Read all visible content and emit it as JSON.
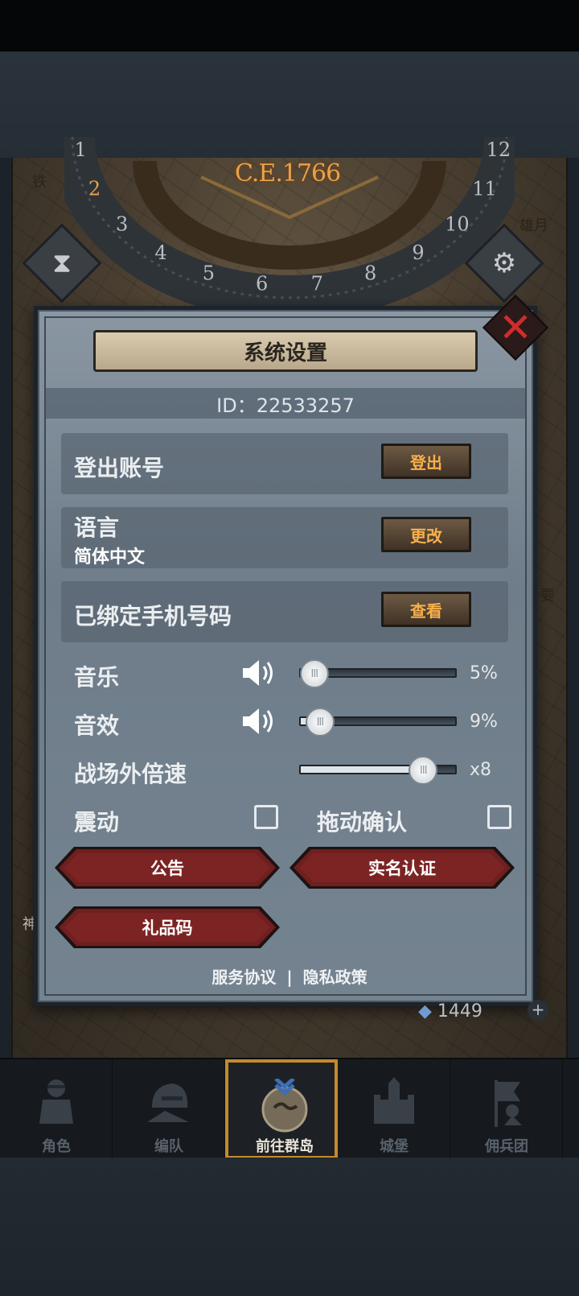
{
  "map": {
    "era": "C.E.1766",
    "dial_numbers": [
      "1",
      "2",
      "3",
      "4",
      "5",
      "6",
      "7",
      "8",
      "9",
      "10",
      "11",
      "12"
    ],
    "labels": {
      "top_left": "铁",
      "top_right": "雄月",
      "side_right": "要",
      "side_left": "神"
    },
    "resource_value": "1449"
  },
  "dialog": {
    "title": "系统设置",
    "id_text": "ID：22533257",
    "rows": {
      "logout": {
        "label": "登出账号",
        "button": "登出"
      },
      "language": {
        "label": "语言",
        "value": "简体中文",
        "button": "更改"
      },
      "phone": {
        "label": "已绑定手机号码",
        "button": "查看"
      }
    },
    "sliders": {
      "music": {
        "label": "音乐",
        "value_text": "5%",
        "level": 0.05
      },
      "sfx": {
        "label": "音效",
        "value_text": "9%",
        "level": 0.09
      },
      "speed": {
        "label": "战场外倍速",
        "value_text": "x8",
        "level": 0.82
      }
    },
    "toggles": {
      "vibration": {
        "label": "震动",
        "checked": false
      },
      "drag_confirm": {
        "label": "拖动确认",
        "checked": false
      }
    },
    "buttons": {
      "notice": "公告",
      "real_name": "实名认证",
      "gift_code": "礼品码"
    },
    "links": {
      "terms": "服务协议",
      "separator": "|",
      "privacy": "隐私政策"
    }
  },
  "nav": [
    {
      "label": "角色",
      "icon": "knight-icon",
      "active": false
    },
    {
      "label": "编队",
      "icon": "squad-helmet-icon",
      "active": false
    },
    {
      "label": "前往群岛",
      "icon": "compass-island-icon",
      "active": true
    },
    {
      "label": "城堡",
      "icon": "castle-icon",
      "active": false
    },
    {
      "label": "佣兵团",
      "icon": "banner-warrior-icon",
      "active": false
    }
  ],
  "colors": {
    "accent_gold": "#f6b04c",
    "close_red": "#d22b2b",
    "button_red": "#6e1f1f",
    "active_border": "#c58a2a"
  }
}
